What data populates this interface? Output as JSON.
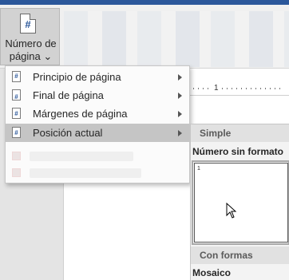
{
  "ribbon": {
    "page_number_button": {
      "icon": "page-number-icon",
      "icon_glyph": "#",
      "label_line1": "Número de",
      "label_line2": "página ⌄"
    }
  },
  "ruler": {
    "mark": "1"
  },
  "menu": {
    "items": [
      {
        "label": "Principio de página",
        "icon": "page-top-icon",
        "submenu_arrow": true
      },
      {
        "label": "Final de página",
        "icon": "page-bottom-icon",
        "submenu_arrow": true
      },
      {
        "label": "Márgenes de página",
        "icon": "page-margins-icon",
        "submenu_arrow": true
      },
      {
        "label": "Posición actual",
        "icon": "current-position-icon",
        "submenu_arrow": true,
        "active": true
      }
    ]
  },
  "gallery": {
    "section_simple": "Simple",
    "item_title": "Número sin formato",
    "preview_number": "1",
    "section_con_formas": "Con formas",
    "next_item_title": "Mosaico"
  },
  "colors": {
    "accent": "#2b579a",
    "menu_active": "#c5c5c5",
    "gallery_section": "#e1e1e1"
  }
}
